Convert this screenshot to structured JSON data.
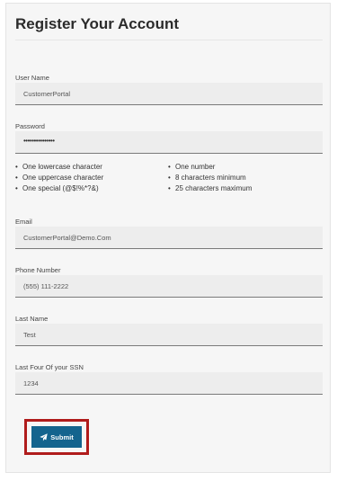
{
  "page": {
    "title": "Register Your Account"
  },
  "fields": {
    "username": {
      "label": "User Name",
      "value": "CustomerPortal"
    },
    "password": {
      "label": "Password",
      "value": "•••••••••••••••"
    },
    "email": {
      "label": "Email",
      "value": "CustomerPortal@Demo.Com"
    },
    "phone": {
      "label": "Phone Number",
      "value": "(555) 111-2222"
    },
    "lastname": {
      "label": "Last Name",
      "value": "Test"
    },
    "ssn": {
      "label": "Last Four Of your SSN",
      "value": "1234"
    }
  },
  "password_rules": {
    "left": [
      "One lowercase character",
      "One uppercase character",
      "One special (@$!%*?&)"
    ],
    "right": [
      "One number",
      "8 characters minimum",
      "25 characters maximum"
    ]
  },
  "submit": {
    "label": "Submit",
    "icon": "paper-plane-icon",
    "highlight_color": "#b01c1c",
    "color": "#14648e"
  }
}
